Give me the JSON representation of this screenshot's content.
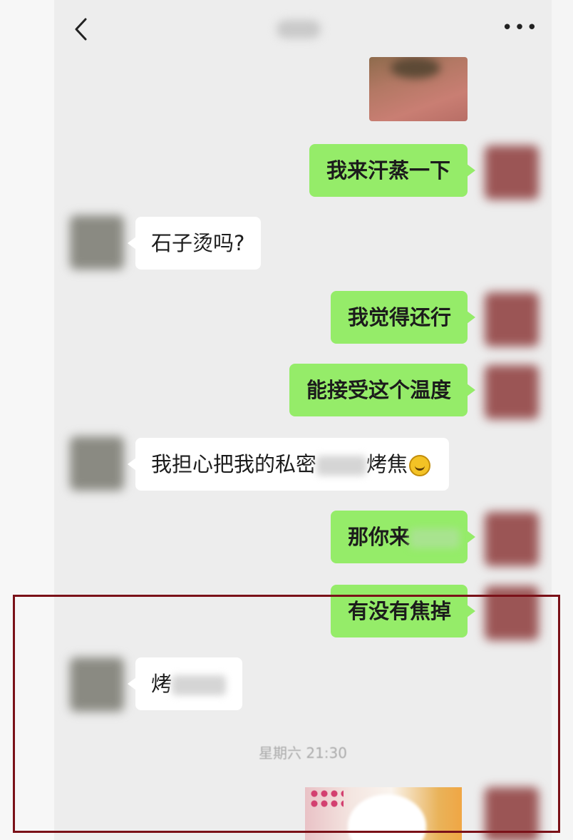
{
  "header": {
    "back_icon": "chevron-left-icon",
    "title": "",
    "more_icon": "ellipsis-icon",
    "more_label": "•••"
  },
  "messages": [
    {
      "side": "me",
      "type": "image"
    },
    {
      "side": "me",
      "type": "text",
      "text": "我来汗蒸一下"
    },
    {
      "side": "other",
      "type": "text",
      "text": "石子烫吗?"
    },
    {
      "side": "me",
      "type": "text",
      "text": "我觉得还行"
    },
    {
      "side": "me",
      "type": "text",
      "text": "能接受这个温度"
    },
    {
      "side": "other",
      "type": "text",
      "text_before": "我担心把我的私密",
      "text_after": "烤焦",
      "emoji": "grimace-emoji"
    },
    {
      "side": "me",
      "type": "text",
      "text": "那你来"
    },
    {
      "side": "me",
      "type": "text",
      "text": "有没有焦掉"
    },
    {
      "side": "other",
      "type": "text",
      "text": "烤"
    },
    {
      "side": "me",
      "type": "image"
    }
  ],
  "timestamp": "星期六 21:30",
  "colors": {
    "background": "#ededed",
    "my_bubble": "#95ec69",
    "other_bubble": "#ffffff",
    "highlight_frame": "#7a1118"
  }
}
